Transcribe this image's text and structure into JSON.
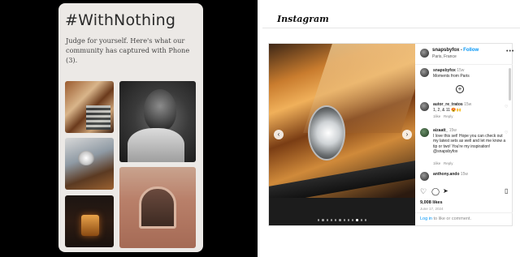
{
  "left_card": {
    "title": "#WithNothing",
    "subtitle": "Judge for yourself. Here's what our community has captured with Phone (3)."
  },
  "instagram": {
    "logo": "Instagram",
    "post": {
      "username": "snapsbyfox",
      "follow_label": "Follow",
      "location": "Paris, France",
      "caption_user": "snapsbyfox",
      "caption_age": "15w",
      "caption_text": "Moments from Paris",
      "comments": [
        {
          "user": "autor_re_tratos",
          "age": "15w",
          "text": "1, 2, & 11 😍🙌",
          "likes": "1like",
          "reply": "Reply"
        },
        {
          "user": "aizaatt_",
          "age": "15w",
          "text": "I love this set! Hope you can check out my latest sets as well and let me know a tip or two! You're my inspiration! @snapsbyfox",
          "likes": "1like",
          "reply": "Reply"
        },
        {
          "user": "anthony.ando",
          "age": "15w",
          "text": ""
        }
      ],
      "likes_count": "9,008 likes",
      "date": "June 17, 2024",
      "login_prefix": "Log in",
      "login_suffix": " to like or comment."
    }
  },
  "icons": [
    "heart-icon",
    "comment-icon",
    "share-icon",
    "bookmark-icon",
    "more-icon",
    "chevron-left-icon",
    "chevron-right-icon",
    "add-icon"
  ]
}
